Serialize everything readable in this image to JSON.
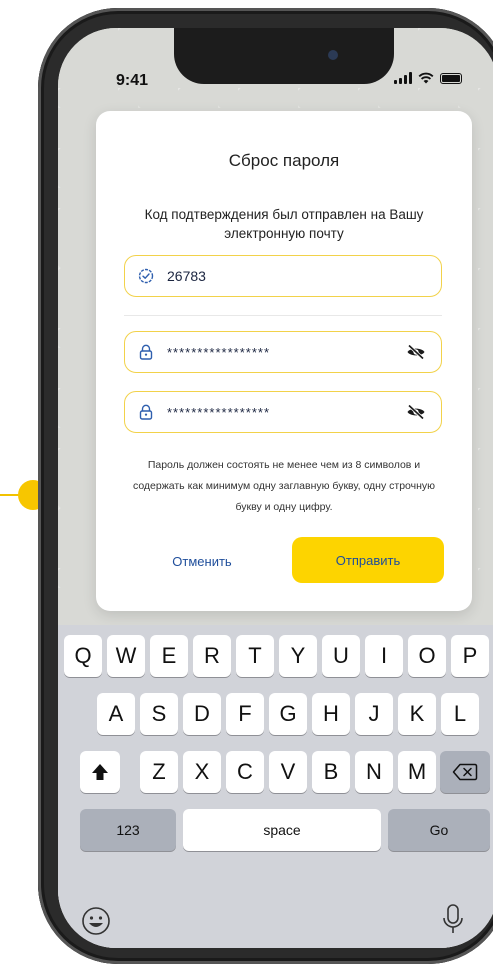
{
  "status_bar": {
    "time": "9:41"
  },
  "dialog": {
    "title": "Сброс пароля",
    "message": "Код подтверждения был отправлен на Вашу электронную почту",
    "code_field": {
      "value": "26783",
      "icon": "check-badge-icon"
    },
    "password_field": {
      "value": "*****************",
      "icon": "lock-icon",
      "toggle_icon": "eye-off-icon"
    },
    "confirm_password_field": {
      "value": "*****************",
      "icon": "lock-icon",
      "toggle_icon": "eye-off-icon"
    },
    "hint": "Пароль должен состоять не менее чем из 8 символов и содержать как минимум одну заглавную букву, одну строчную букву и одну цифру.",
    "cancel_label": "Отменить",
    "submit_label": "Отправить"
  },
  "keyboard": {
    "row1": [
      "Q",
      "W",
      "E",
      "R",
      "T",
      "Y",
      "U",
      "I",
      "O",
      "P"
    ],
    "row2": [
      "A",
      "S",
      "D",
      "F",
      "G",
      "H",
      "J",
      "K",
      "L"
    ],
    "row3": [
      "Z",
      "X",
      "C",
      "V",
      "B",
      "N",
      "M"
    ],
    "numbers_label": "123",
    "space_label": "space",
    "go_label": "Go"
  },
  "colors": {
    "accent_yellow": "#FDD400",
    "link_blue": "#1F4E9B",
    "field_border": "#F2D24A"
  }
}
